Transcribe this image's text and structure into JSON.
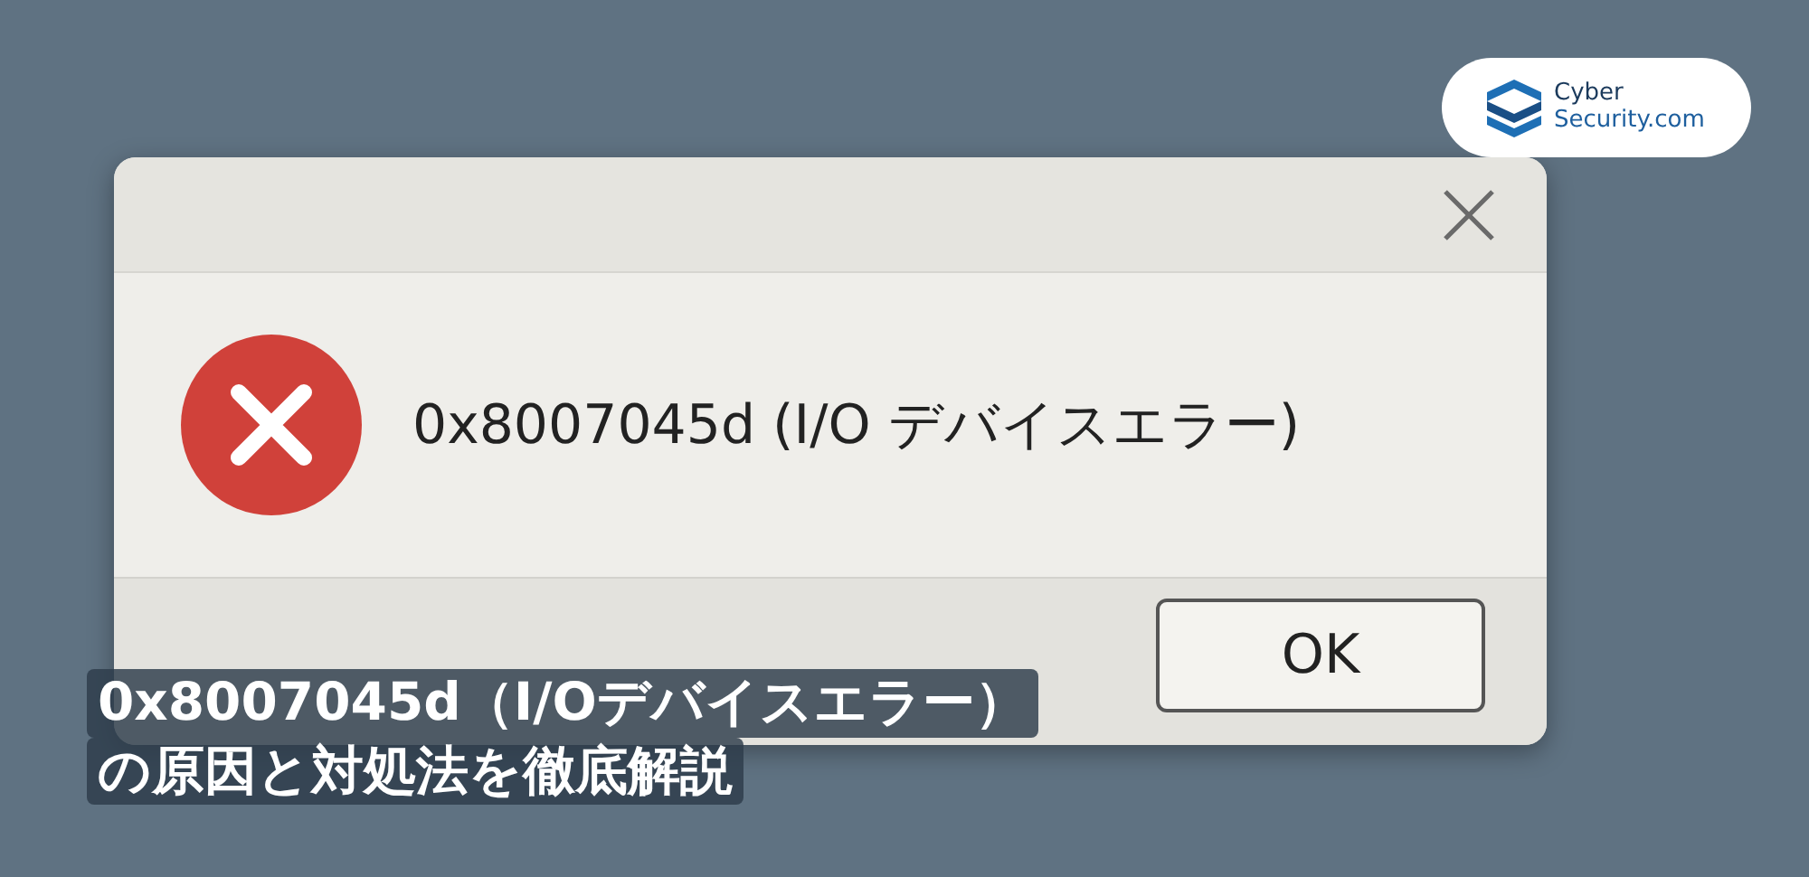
{
  "logo": {
    "lines": [
      "Cyber",
      "Security.com"
    ]
  },
  "dialog": {
    "message": "0x8007045d (I/O デバイスエラー)",
    "buttons": [
      "OK"
    ]
  },
  "headline": [
    "0x8007045d（I/Oデバイスエラー）",
    "の原因と対処法を徹底解説"
  ]
}
